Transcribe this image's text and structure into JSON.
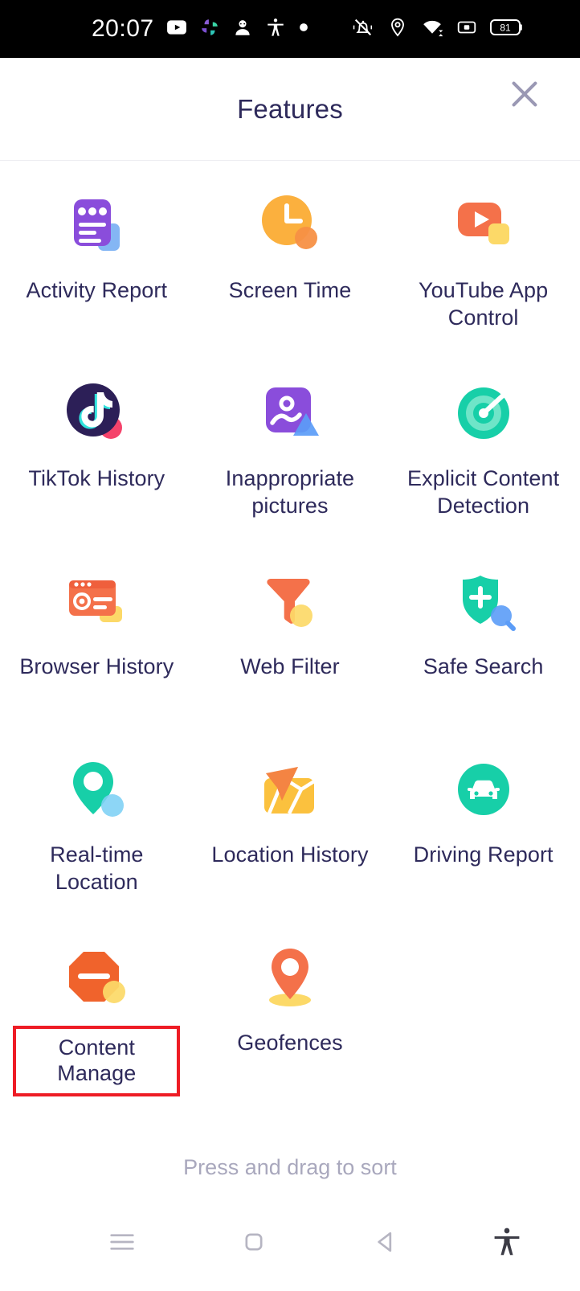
{
  "status_bar": {
    "time": "20:07",
    "left_icons": [
      "youtube-icon",
      "google-photos-icon",
      "contact-avatar-icon",
      "accessibility-icon",
      "dot-icon"
    ],
    "right_icons": [
      "ringer-vibrate-off-icon",
      "location-icon",
      "wifi-icon",
      "sim-card-icon",
      "battery-icon"
    ],
    "battery_level": "81"
  },
  "header": {
    "title": "Features",
    "close_label": "close-icon"
  },
  "features": [
    {
      "id": "activity-report",
      "label": "Activity Report",
      "icon": "activity-report-icon"
    },
    {
      "id": "screen-time",
      "label": "Screen Time",
      "icon": "screen-time-icon"
    },
    {
      "id": "youtube-app-control",
      "label": "YouTube App Control",
      "icon": "youtube-app-control-icon"
    },
    {
      "id": "tiktok-history",
      "label": "TikTok History",
      "icon": "tiktok-history-icon"
    },
    {
      "id": "inappropriate-pictures",
      "label": "Inappropriate pictures",
      "icon": "inappropriate-pictures-icon"
    },
    {
      "id": "explicit-content-detection",
      "label": "Explicit Content Detection",
      "icon": "explicit-content-detection-icon"
    },
    {
      "id": "browser-history",
      "label": "Browser History",
      "icon": "browser-history-icon"
    },
    {
      "id": "web-filter",
      "label": "Web Filter",
      "icon": "web-filter-icon"
    },
    {
      "id": "safe-search",
      "label": "Safe Search",
      "icon": "safe-search-icon"
    },
    {
      "id": "real-time-location",
      "label": "Real-time Location",
      "icon": "real-time-location-icon"
    },
    {
      "id": "location-history",
      "label": "Location History",
      "icon": "location-history-icon"
    },
    {
      "id": "driving-report",
      "label": "Driving Report",
      "icon": "driving-report-icon"
    },
    {
      "id": "content-manage",
      "label": "Content Manage",
      "icon": "content-manage-icon",
      "highlighted": true
    },
    {
      "id": "geofences",
      "label": "Geofences",
      "icon": "geofences-icon"
    }
  ],
  "footer": {
    "sort_hint": "Press and drag to sort"
  },
  "nav_bar": {
    "items": [
      "menu-icon",
      "home-square-icon",
      "back-triangle-icon",
      "accessibility-icon"
    ]
  },
  "colors": {
    "text_primary": "#2e2a5b",
    "muted": "#a9a8bd",
    "highlight_box": "#ee1c25",
    "purple": "#8a4ddb",
    "amber": "#fbb03e",
    "orange": "#f4714a",
    "teal": "#17cfa8",
    "blue": "#84b6f4",
    "yellow": "#fcd968",
    "status_bar_bg": "#000000"
  }
}
